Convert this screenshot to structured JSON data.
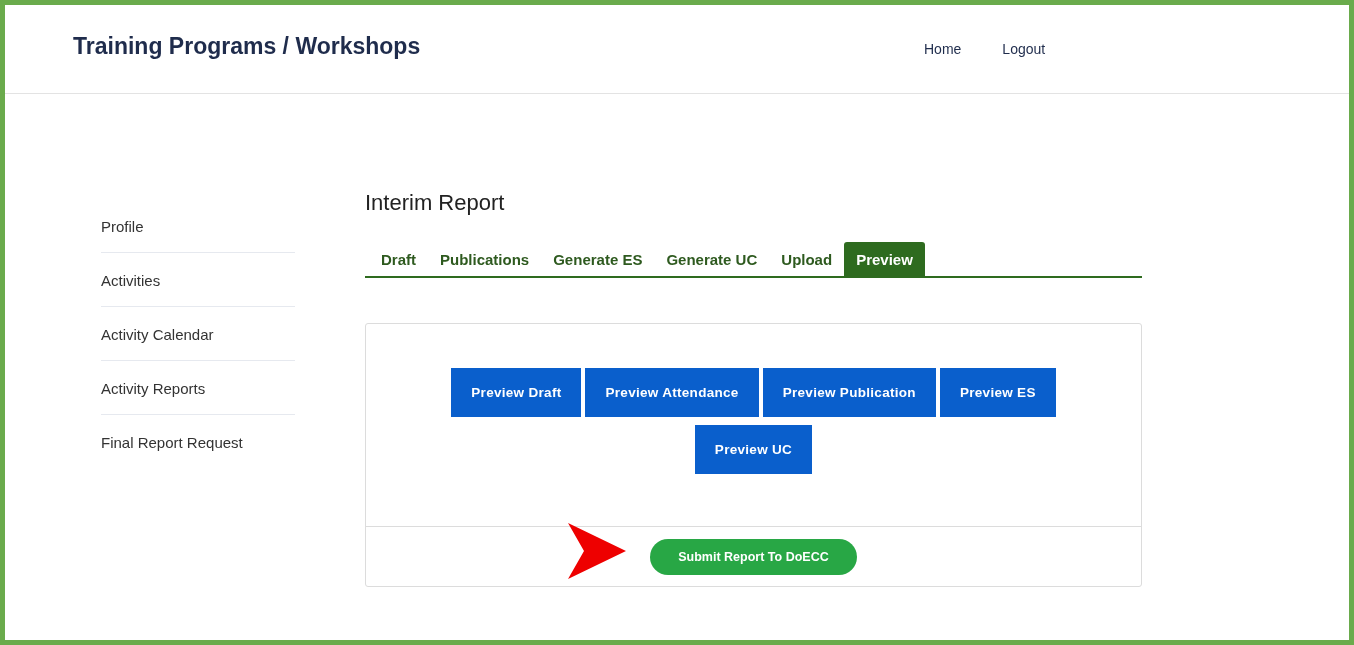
{
  "header": {
    "title": "Training Programs / Workshops",
    "nav": [
      "Home",
      "Logout"
    ]
  },
  "sidebar": {
    "items": [
      "Profile",
      "Activities",
      "Activity Calendar",
      "Activity Reports",
      "Final Report Request"
    ]
  },
  "main": {
    "heading": "Interim Report",
    "tabs": [
      {
        "label": "Draft",
        "selected": false
      },
      {
        "label": "Publications",
        "selected": false
      },
      {
        "label": "Generate ES",
        "selected": false
      },
      {
        "label": "Generate UC",
        "selected": false
      },
      {
        "label": "Upload",
        "selected": false
      },
      {
        "label": "Preview",
        "selected": true
      }
    ],
    "preview_buttons": [
      "Preview Draft",
      "Preview Attendance",
      "Preview Publication",
      "Preview ES",
      "Preview UC"
    ],
    "submit_button": "Submit Report To DoECC"
  }
}
